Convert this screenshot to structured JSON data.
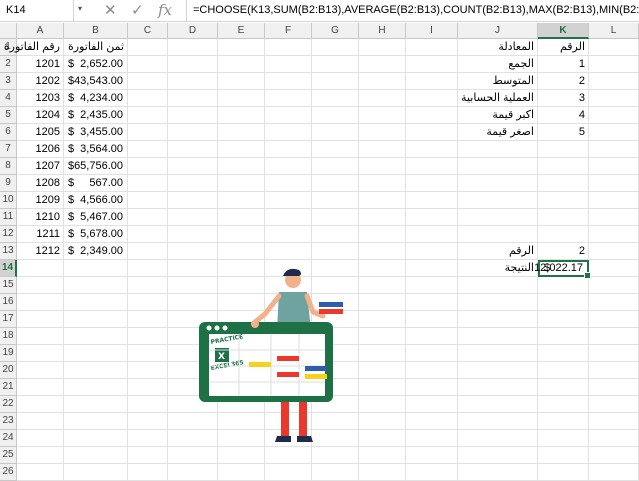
{
  "name_box": "K14",
  "formula": "=CHOOSE(K13,SUM(B2:B13),AVERAGE(B2:B13),COUNT(B2:B13),MAX(B2:B13),MIN(B2:B13))",
  "icons": {
    "cancel": "✕",
    "enter": "✓",
    "fx": "fx",
    "dropdown": "▾"
  },
  "columns": [
    "A",
    "B",
    "C",
    "D",
    "E",
    "F",
    "G",
    "H",
    "I",
    "J",
    "K",
    "L"
  ],
  "selected_column": "K",
  "rows": [
    "1",
    "2",
    "3",
    "4",
    "5",
    "6",
    "7",
    "8",
    "9",
    "10",
    "11",
    "12",
    "13",
    "14",
    "15",
    "16",
    "17",
    "18",
    "19",
    "20",
    "21",
    "22",
    "23",
    "24",
    "25",
    "26"
  ],
  "selected_row": "14",
  "header": {
    "a1": "رقم الفاتورة",
    "b1": "ثمن الفاتورة",
    "j1": "المعادلة",
    "k1": "الرقم"
  },
  "invoices": [
    {
      "num": "1201",
      "sym": "$",
      "amt": "2,652.00"
    },
    {
      "num": "1202",
      "sym": "$",
      "amt": "43,543.00"
    },
    {
      "num": "1203",
      "sym": "$",
      "amt": "4,234.00"
    },
    {
      "num": "1204",
      "sym": "$",
      "amt": "2,435.00"
    },
    {
      "num": "1205",
      "sym": "$",
      "amt": "3,455.00"
    },
    {
      "num": "1206",
      "sym": "$",
      "amt": "3,564.00"
    },
    {
      "num": "1207",
      "sym": "$",
      "amt": "65,756.00"
    },
    {
      "num": "1208",
      "sym": "$",
      "amt": "567.00"
    },
    {
      "num": "1209",
      "sym": "$",
      "amt": "4,566.00"
    },
    {
      "num": "1210",
      "sym": "$",
      "amt": "5,467.00"
    },
    {
      "num": "1211",
      "sym": "$",
      "amt": "5,678.00"
    },
    {
      "num": "1212",
      "sym": "$",
      "amt": "2,349.00"
    }
  ],
  "functions": [
    {
      "name": "الجمع",
      "index": "1"
    },
    {
      "name": "المتوسط",
      "index": "2"
    },
    {
      "name": "العملية الحسابية",
      "index": "3"
    },
    {
      "name": "اكبر قيمة",
      "index": "4"
    },
    {
      "name": "اصغر قيمة",
      "index": "5"
    }
  ],
  "selector": {
    "label": "الرقم",
    "value": "2"
  },
  "result": {
    "label": "النتيجة",
    "sym": "$",
    "amt": "12,022.17"
  },
  "illustration": {
    "logo_text": "PRACTICE EXCEL365",
    "colors": {
      "green": "#1e7145",
      "red": "#e8392c",
      "blue": "#2b5fad",
      "yellow": "#f6d21f"
    }
  }
}
